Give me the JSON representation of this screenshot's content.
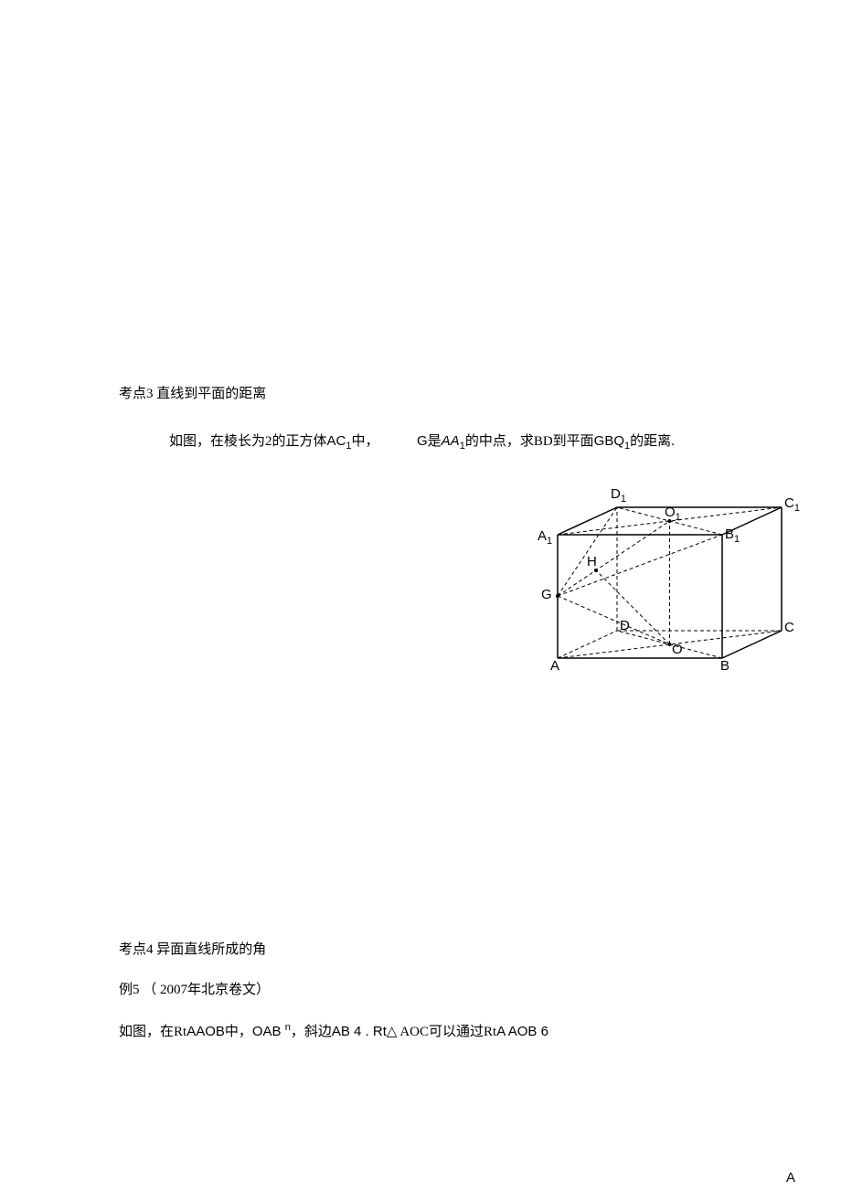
{
  "section1": {
    "title": "考点3 直线到平面的距离",
    "problem_a": "如图，在棱长为2的正方体",
    "problem_b": "AC",
    "problem_b_sub": "1",
    "problem_c": "中，",
    "problem_d": "G是",
    "problem_e": "AA",
    "problem_e_sub": "1",
    "problem_f": "的中点，求BD到平面",
    "problem_g": "GBQ",
    "problem_g_sub": "1",
    "problem_h": "的距离."
  },
  "figure": {
    "labels": {
      "D1": "D",
      "C1": "C",
      "A1": "A",
      "B1": "B",
      "O1": "O",
      "G": "G",
      "H": "H",
      "D": "D",
      "C": "C",
      "A": "A",
      "B": "B",
      "O": "O",
      "sub1": "1"
    }
  },
  "section2": {
    "title": "考点4 异面直线所成的角",
    "example": "例5 （ 2007年北京卷文）",
    "line_a": "如图，在Rt",
    "line_b": "AAOB中，OAB ",
    "line_c": "n",
    "line_d": "，斜边",
    "line_e": "AB 4 .  Rt",
    "line_f": "△  AOC可以通过Rt",
    "line_g": "A AOB 6"
  },
  "footer": {
    "letter": "A"
  }
}
